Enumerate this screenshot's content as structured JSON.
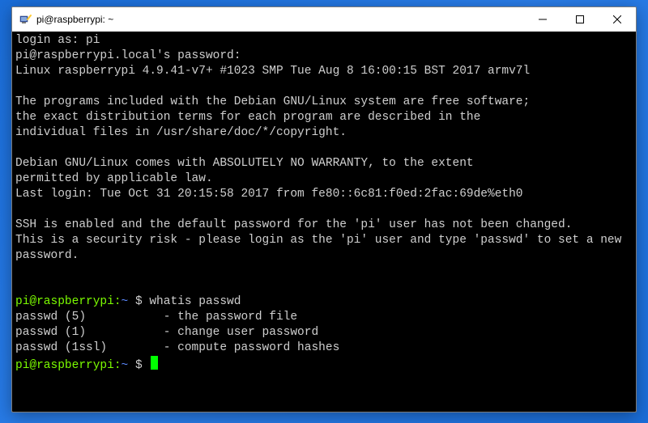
{
  "window": {
    "title": "pi@raspberrypi: ~"
  },
  "terminal": {
    "login_lines": [
      "login as: pi",
      "pi@raspberrypi.local's password:",
      "Linux raspberrypi 4.9.41-v7+ #1023 SMP Tue Aug 8 16:00:15 BST 2017 armv7l",
      "",
      "The programs included with the Debian GNU/Linux system are free software;",
      "the exact distribution terms for each program are described in the",
      "individual files in /usr/share/doc/*/copyright.",
      "",
      "Debian GNU/Linux comes with ABSOLUTELY NO WARRANTY, to the extent",
      "permitted by applicable law.",
      "Last login: Tue Oct 31 20:15:58 2017 from fe80::6c81:f0ed:2fac:69de%eth0",
      "",
      "SSH is enabled and the default password for the 'pi' user has not been changed.",
      "This is a security risk - please login as the 'pi' user and type 'passwd' to set a new password.",
      "",
      ""
    ],
    "prompt_user": "pi@raspberrypi",
    "prompt_path": "~",
    "prompt_dollar": "$",
    "command1": "whatis passwd",
    "whatis_output": [
      "passwd (5)           - the password file",
      "passwd (1)           - change user password",
      "passwd (1ssl)        - compute password hashes"
    ]
  }
}
